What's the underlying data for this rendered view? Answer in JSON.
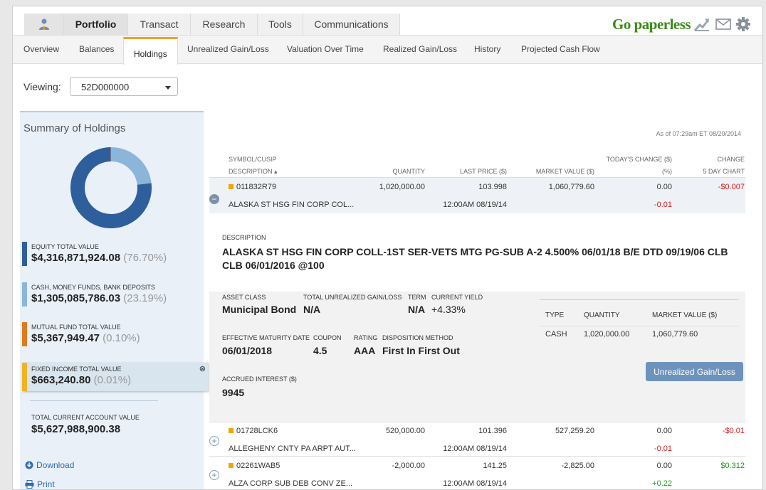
{
  "topnav": {
    "tabs": [
      {
        "label": "Portfolio",
        "active": true
      },
      {
        "label": "Transact"
      },
      {
        "label": "Research"
      },
      {
        "label": "Tools"
      },
      {
        "label": "Communications"
      }
    ],
    "go_paperless": "Go paperless",
    "brand_green": "#3a8a1a"
  },
  "subnav": {
    "tabs": [
      "Overview",
      "Balances",
      "Holdings",
      "Unrealized Gain/Loss",
      "Valuation Over Time",
      "Realized Gain/Loss",
      "History",
      "Projected Cash Flow"
    ],
    "active": "Holdings"
  },
  "viewing": {
    "label": "Viewing:",
    "value": "52D000000"
  },
  "summary": {
    "title": "Summary of Holdings",
    "donut_fractions": [
      0.767,
      0.2319,
      0.001,
      0.0001
    ],
    "items": [
      {
        "label": "EQUITY TOTAL VALUE",
        "value": "$4,316,871,924.08",
        "pct": "(76.70%)",
        "color": "#2e5f9c"
      },
      {
        "label": "CASH, MONEY FUNDS, BANK DEPOSITS",
        "value": "$1,305,085,786.03",
        "pct": "(23.19%)",
        "color": "#8bb6d9"
      },
      {
        "label": "MUTUAL FUND TOTAL VALUE",
        "value": "$5,367,949.47",
        "pct": "(0.10%)",
        "color": "#e07b1a"
      },
      {
        "label": "FIXED INCOME TOTAL VALUE",
        "value": "$663,240.80",
        "pct": "(0.01%)",
        "color": "#f0b323"
      }
    ],
    "total_label": "TOTAL CURRENT ACCOUNT VALUE",
    "total_value": "$5,627,988,900.38",
    "download": "Download",
    "print": "Print"
  },
  "holdings": {
    "as_of": "As of 07:29am ET 08/20/2014",
    "headers": {
      "symbol": "SYMBOL/CUSIP",
      "description": "DESCRIPTION ▴",
      "quantity": "QUANTITY",
      "last_price": "LAST PRICE ($)",
      "market_value": "MARKET VALUE ($)",
      "todays_change": "TODAY'S CHANGE ($)",
      "todays_change_pct": "(%)",
      "change": "CHANGE",
      "five_day": "5 DAY CHART"
    },
    "rows": [
      {
        "symbol": "011832R79",
        "description": "ALASKA ST HSG FIN CORP COL...",
        "quantity": "1,020,000.00",
        "last_price": "103.998",
        "price_time": "12:00AM 08/19/14",
        "market_value": "1,060,779.60",
        "change": "0.00",
        "change_pct": "-0.01",
        "five_day": "-$0.007"
      },
      {
        "symbol": "01728LCK6",
        "description": "ALLEGHENY CNTY PA ARPT AUT...",
        "quantity": "520,000.00",
        "last_price": "101.396",
        "price_time": "12:00AM 08/19/14",
        "market_value": "527,259.20",
        "change": "0.00",
        "change_pct": "-0.01",
        "five_day": "-$0.01"
      },
      {
        "symbol": "02261WAB5",
        "description": "ALZA CORP SUB DEB CONV ZE...",
        "quantity": "-2,000.00",
        "last_price": "141.25",
        "price_time": "12:00AM 08/19/14",
        "market_value": "-2,825.00",
        "change": "0.00",
        "change_pct": "+0.22",
        "five_day": "$0.312"
      }
    ],
    "detail": {
      "description_label": "DESCRIPTION",
      "description": "ALASKA ST HSG FIN CORP COLL-1ST SER-VETS MTG PG-SUB A-2 4.500% 06/01/18 B/E DTD 09/19/06 CLB CLB 06/01/2016 @100",
      "asset_class_label": "ASSET CLASS",
      "asset_class": "Municipal Bond",
      "unrealized_label": "TOTAL UNREALIZED GAIN/LOSS",
      "unrealized": "N/A",
      "term_label": "TERM",
      "term": "N/A",
      "yield_label": "CURRENT YIELD",
      "yield": "+4.33%",
      "maturity_label": "EFFECTIVE MATURITY DATE",
      "maturity": "06/01/2018",
      "coupon_label": "COUPON",
      "coupon": "4.5",
      "rating_label": "RATING",
      "rating": "AAA",
      "disposition_label": "DISPOSITION METHOD",
      "disposition": "First In First Out",
      "accrued_label": "ACCRUED INTEREST ($)",
      "accrued": "9945",
      "lot_headers": [
        "TYPE",
        "QUANTITY",
        "MARKET VALUE ($)"
      ],
      "lot": {
        "type": "CASH",
        "quantity": "1,020,000.00",
        "market_value": "1,060,779.60"
      },
      "button": "Unrealized Gain/Loss"
    }
  }
}
